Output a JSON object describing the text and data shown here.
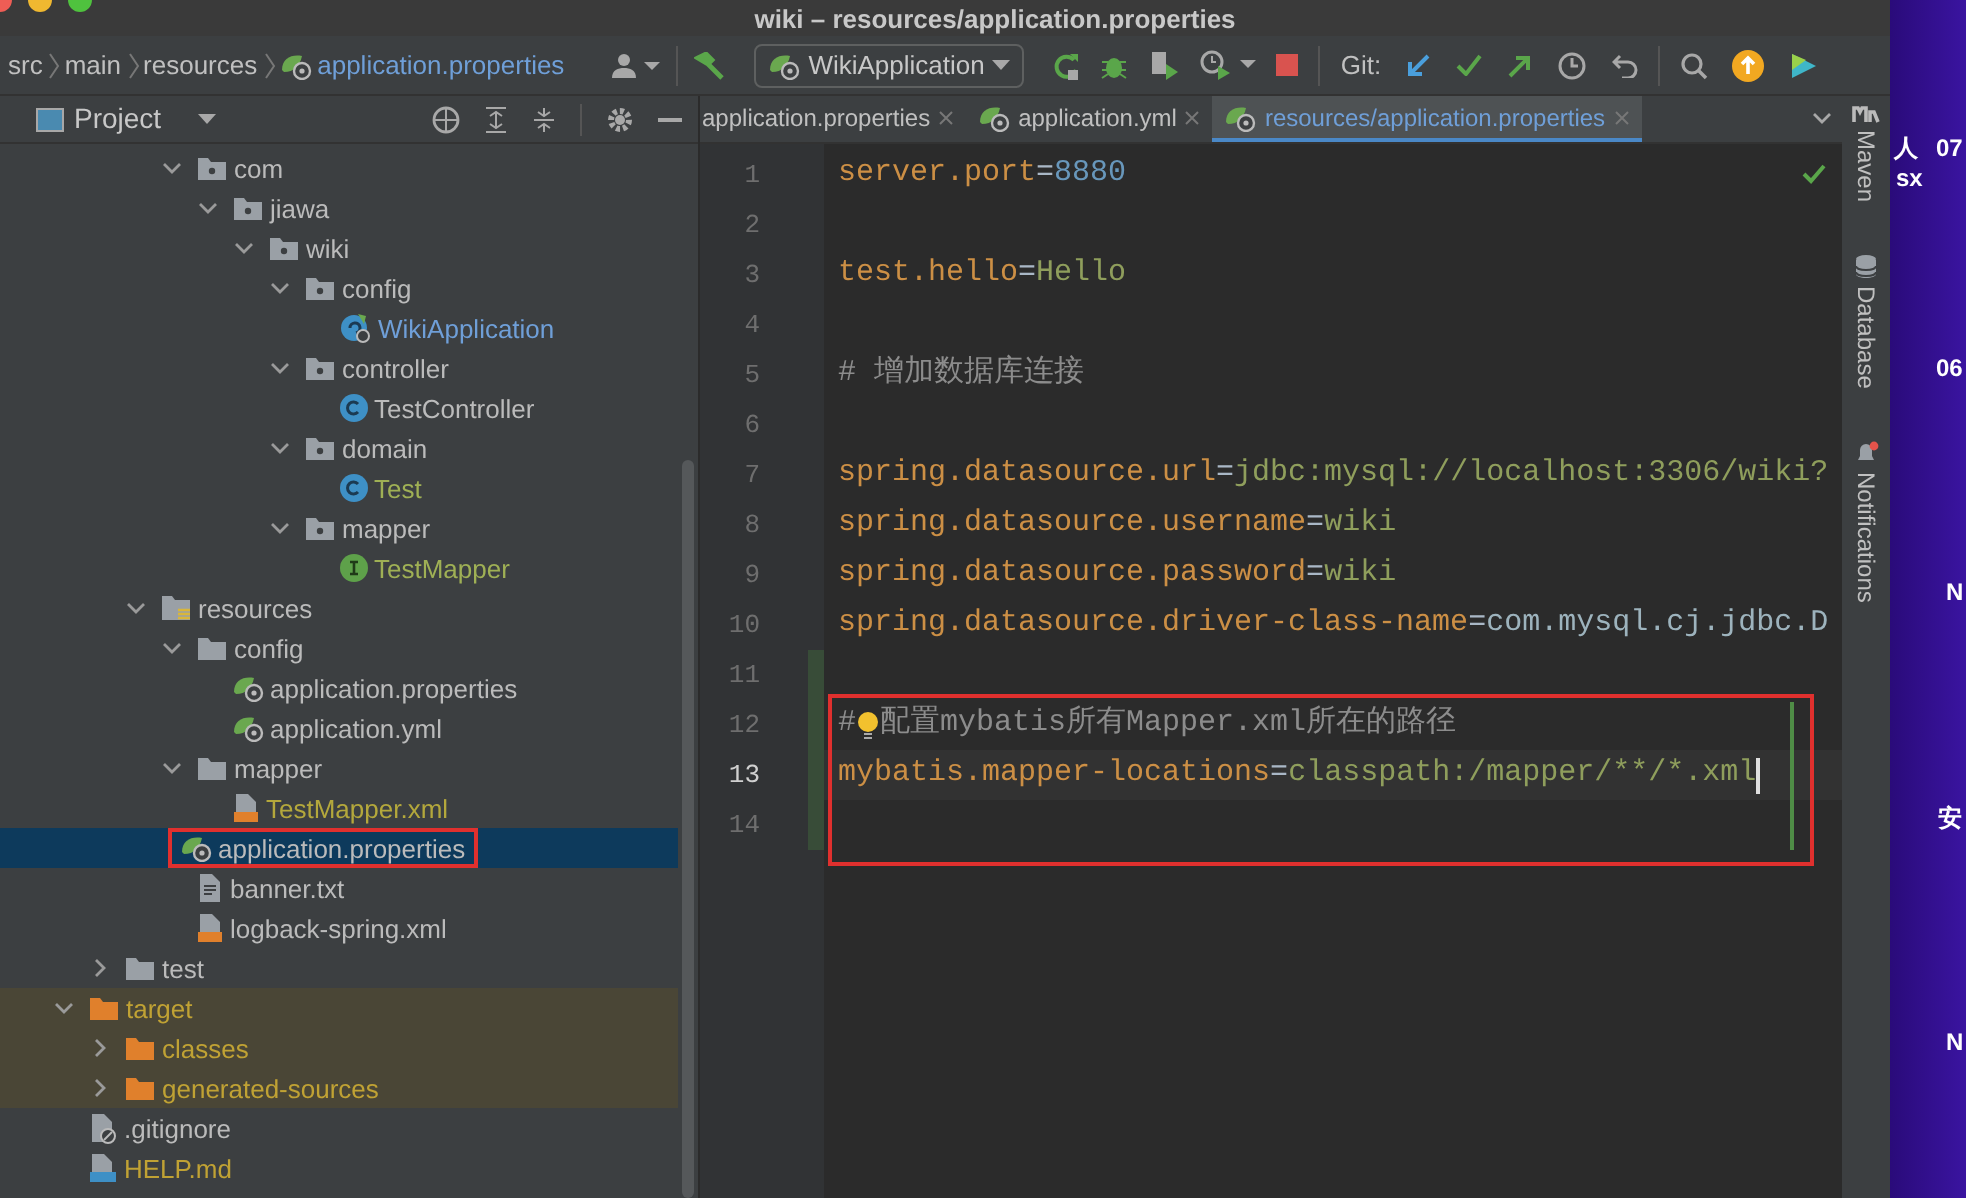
{
  "window": {
    "title": "wiki – resources/application.properties"
  },
  "breadcrumb": [
    {
      "label": "src",
      "kind": "folder"
    },
    {
      "label": "main",
      "kind": "folder"
    },
    {
      "label": "resources",
      "kind": "folder"
    },
    {
      "label": "application.properties",
      "kind": "file"
    }
  ],
  "toolbar": {
    "run_config": "WikiApplication",
    "git_label": "Git:"
  },
  "project_panel": {
    "title": "Project"
  },
  "tree": [
    {
      "children": [
        {
          "children": [
            {
              "children": [
                {
                  "label": "com",
                  "kind": "package",
                  "expanded": true,
                  "children": [
                    {
                      "label": "jiawa",
                      "kind": "package",
                      "expanded": true,
                      "children": [
                        {
                          "label": "wiki",
                          "kind": "package",
                          "expanded": true,
                          "children": [
                            {
                              "label": "config",
                              "kind": "package",
                              "expanded": true,
                              "children": [
                                {
                                  "label": "WikiApplication",
                                  "kind": "spring-class",
                                  "selected": false,
                                  "color": "#6f9fd8"
                                }
                              ]
                            },
                            {
                              "label": "controller",
                              "kind": "package",
                              "expanded": true,
                              "children": [
                                {
                                  "label": "TestController",
                                  "kind": "class",
                                  "selected": false
                                }
                              ]
                            },
                            {
                              "label": "domain",
                              "kind": "package",
                              "expanded": true,
                              "children": [
                                {
                                  "label": "Test",
                                  "kind": "class",
                                  "selected": false,
                                  "color": "#9fb055"
                                }
                              ]
                            },
                            {
                              "label": "mapper",
                              "kind": "package",
                              "expanded": true,
                              "children": [
                                {
                                  "label": "TestMapper",
                                  "kind": "interface",
                                  "selected": false,
                                  "color": "#9fb055"
                                }
                              ]
                            }
                          ]
                        }
                      ]
                    }
                  ]
                }
              ]
            },
            {
              "label": "resources",
              "kind": "resources-folder",
              "expanded": true,
              "children": [
                {
                  "label": "config",
                  "kind": "folder",
                  "expanded": true,
                  "children": [
                    {
                      "label": "application.properties",
                      "kind": "spring-config",
                      "selected": false
                    },
                    {
                      "label": "application.yml",
                      "kind": "spring-config",
                      "selected": false
                    }
                  ]
                },
                {
                  "label": "mapper",
                  "kind": "folder",
                  "expanded": true,
                  "children": [
                    {
                      "label": "TestMapper.xml",
                      "kind": "xml",
                      "selected": false,
                      "color": "#b4a83c"
                    }
                  ]
                },
                {
                  "label": "application.properties",
                  "kind": "spring-config",
                  "selected": true
                },
                {
                  "label": "banner.txt",
                  "kind": "text",
                  "selected": false
                },
                {
                  "label": "logback-spring.xml",
                  "kind": "xml",
                  "selected": false
                }
              ]
            }
          ]
        },
        {
          "label": "test",
          "kind": "folder",
          "expanded": false
        }
      ]
    },
    {
      "label": "target",
      "kind": "excluded-folder",
      "expanded": true,
      "excluded": true,
      "color": "#c0a234",
      "children": [
        {
          "label": "classes",
          "kind": "excluded-folder",
          "expanded": false,
          "excluded": true,
          "color": "#c0a234"
        },
        {
          "label": "generated-sources",
          "kind": "excluded-folder",
          "expanded": false,
          "excluded": true,
          "color": "#c0a234"
        }
      ]
    },
    {
      "label": ".gitignore",
      "kind": "gitignore",
      "selected": false
    },
    {
      "label": "HELP.md",
      "kind": "markdown",
      "selected": false,
      "color": "#c0a234"
    }
  ],
  "tabs": [
    {
      "label": "application.properties",
      "selected": false
    },
    {
      "label": "application.yml",
      "selected": false
    },
    {
      "label": "resources/application.properties",
      "selected": true
    }
  ],
  "editor": {
    "lines": [
      {
        "number": "1",
        "tokens": [
          {
            "text": "server.port",
            "kind": "key"
          },
          {
            "text": "=",
            "kind": "sep"
          },
          {
            "text": "8880",
            "kind": "number"
          }
        ]
      },
      {
        "number": "2"
      },
      {
        "number": "3",
        "tokens": [
          {
            "text": "test.hello",
            "kind": "key"
          },
          {
            "text": "=",
            "kind": "sep"
          },
          {
            "text": "Hello",
            "kind": "value"
          }
        ]
      },
      {
        "number": "4"
      },
      {
        "number": "5",
        "tokens": [
          {
            "text": "# 增加数据库连接",
            "kind": "comment"
          }
        ]
      },
      {
        "number": "6"
      },
      {
        "number": "7",
        "tokens": [
          {
            "text": "spring.datasource.url",
            "kind": "key"
          },
          {
            "text": "=",
            "kind": "sep"
          },
          {
            "text": "jdbc:mysql://localhost:3306/wiki?",
            "kind": "value"
          }
        ]
      },
      {
        "number": "8",
        "tokens": [
          {
            "text": "spring.datasource.username",
            "kind": "key"
          },
          {
            "text": "=",
            "kind": "sep"
          },
          {
            "text": "wiki",
            "kind": "value"
          }
        ]
      },
      {
        "number": "9",
        "tokens": [
          {
            "text": "spring.datasource.password",
            "kind": "key"
          },
          {
            "text": "=",
            "kind": "sep"
          },
          {
            "text": "wiki",
            "kind": "value"
          }
        ]
      },
      {
        "number": "10",
        "tokens": [
          {
            "text": "spring.datasource.driver-class-name",
            "kind": "key"
          },
          {
            "text": "=",
            "kind": "sep"
          },
          {
            "text": "com.mysql.cj.jdbc.D",
            "kind": "class"
          }
        ]
      },
      {
        "number": "11",
        "changed": true
      },
      {
        "number": "12",
        "changed": true,
        "tokens": [
          {
            "text": "#",
            "kind": "comment"
          },
          {
            "kind": "bulb"
          },
          {
            "text": "配置mybatis所有Mapper.xml所在的路径",
            "kind": "comment"
          }
        ]
      },
      {
        "number": "13",
        "changed": true,
        "current": true,
        "tokens": [
          {
            "text": "mybatis.mapper-locations",
            "kind": "key"
          },
          {
            "text": "=",
            "kind": "sep"
          },
          {
            "text": "classpath:/mapper/**/*.xml",
            "kind": "value"
          }
        ]
      },
      {
        "number": "14",
        "changed": true
      }
    ]
  },
  "tool_windows": [
    {
      "label": "Maven",
      "kind": "maven"
    },
    {
      "label": "Database",
      "kind": "database"
    },
    {
      "label": "Notifications",
      "kind": "notifications"
    }
  ],
  "side_strip": [
    "人",
    "07",
    "sx",
    "06",
    "N",
    "安",
    "N"
  ]
}
